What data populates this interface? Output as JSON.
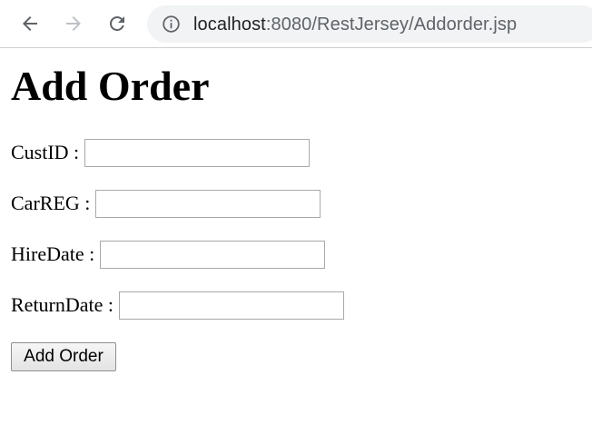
{
  "browser": {
    "icons": {
      "back": "back-arrow-icon",
      "forward": "forward-arrow-icon",
      "reload": "reload-icon",
      "info": "info-icon"
    },
    "url_host": "localhost",
    "url_rest": ":8080/RestJersey/Addorder.jsp"
  },
  "page": {
    "title": "Add Order"
  },
  "form": {
    "fields": [
      {
        "label": "CustID :",
        "value": "",
        "placeholder": ""
      },
      {
        "label": "CarREG :",
        "value": "",
        "placeholder": ""
      },
      {
        "label": "HireDate :",
        "value": "",
        "placeholder": ""
      },
      {
        "label": "ReturnDate :",
        "value": "",
        "placeholder": ""
      }
    ],
    "submit_label": "Add Order"
  },
  "colors": {
    "omnibox_bg": "#f1f3f4",
    "url_host": "#202124",
    "url_path": "#5f6368",
    "nav_active": "#5f6368",
    "nav_disabled": "#bdc1c6"
  }
}
